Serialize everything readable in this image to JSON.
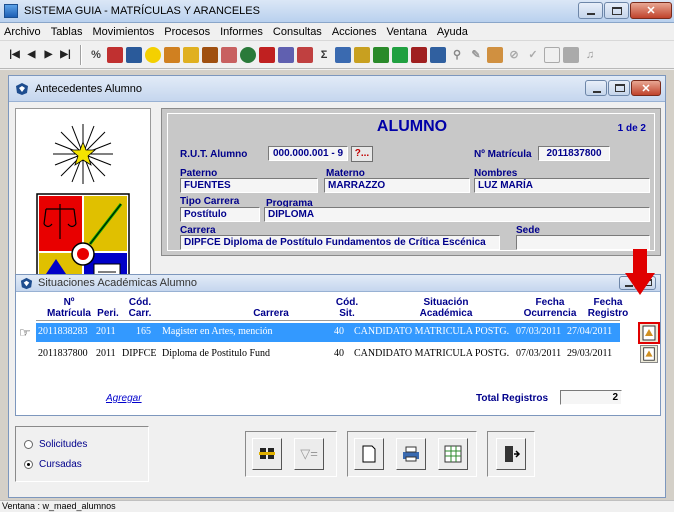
{
  "app": {
    "title": "SISTEMA GUIA - MATRÍCULAS Y ARANCELES"
  },
  "menu": [
    "Archivo",
    "Tablas",
    "Movimientos",
    "Procesos",
    "Informes",
    "Consultas",
    "Acciones",
    "Ventana",
    "Ayuda"
  ],
  "toolbar": {
    "nav": [
      "|◀",
      "◀",
      "▶",
      "▶|"
    ]
  },
  "child_window": {
    "title": "Antecedentes Alumno"
  },
  "alumno": {
    "header": "ALUMNO",
    "pager": "1 de 2",
    "rut_label": "R.U.T. Alumno",
    "rut_value": "000.000.001 - 9",
    "lookup_label": "?...",
    "matricula_label": "Nº Matrícula",
    "matricula_value": "2011837800",
    "paterno_label": "Paterno",
    "paterno_value": "FUENTES",
    "materno_label": "Materno",
    "materno_value": "MARRAZZO",
    "nombres_label": "Nombres",
    "nombres_value": "LUZ MARÍA",
    "tipo_label": "Tipo Carrera",
    "tipo_value": "Postítulo",
    "programa_label": "Programa",
    "programa_value": "DIPLOMA",
    "carrera_label": "Carrera",
    "carrera_value": "DIPFCE  Diploma de Postítulo Fundamentos de Crítica Escénica",
    "sede_label": "Sede",
    "sede_value": ""
  },
  "situaciones": {
    "title": "Situaciones Académicas Alumno",
    "columns": {
      "matricula": "Nº\nMatrícula",
      "peri": "Peri.",
      "cod_carr": "Cód.\nCarr.",
      "carrera": "Carrera",
      "cod_sit": "Cód.\nSit.",
      "situacion": "Situación\nAcadémica",
      "fecha_ocurrencia": "Fecha\nOcurrencia",
      "fecha_registro": "Fecha\nRegistro"
    },
    "rows": [
      {
        "matricula": "2011838283",
        "peri": "2011",
        "cod_carr": "165",
        "carrera": "Magister en Artes, mención",
        "cod_sit": "40",
        "situacion": "CANDIDATO MATRICULA POSTG.",
        "fecha_ocurrencia": "07/03/2011",
        "fecha_registro": "27/04/2011"
      },
      {
        "matricula": "2011837800",
        "peri": "2011",
        "cod_carr": "DIPFCE",
        "carrera": "Diploma de Postitulo Fund",
        "cod_sit": "40",
        "situacion": "CANDIDATO MATRICULA POSTG.",
        "fecha_ocurrencia": "07/03/2011",
        "fecha_registro": "29/03/2011"
      }
    ],
    "agregar": "Agregar",
    "total_label": "Total Registros",
    "total_value": "2"
  },
  "radios": {
    "solicitudes": "Solicitudes",
    "cursadas": "Cursadas",
    "selected": "cursadas"
  },
  "status_bar": "Ventana : w_maed_alumnos",
  "colors": {
    "selection": "#3399ff",
    "label_blue": "#00008b",
    "annotation_red": "#e00000"
  }
}
